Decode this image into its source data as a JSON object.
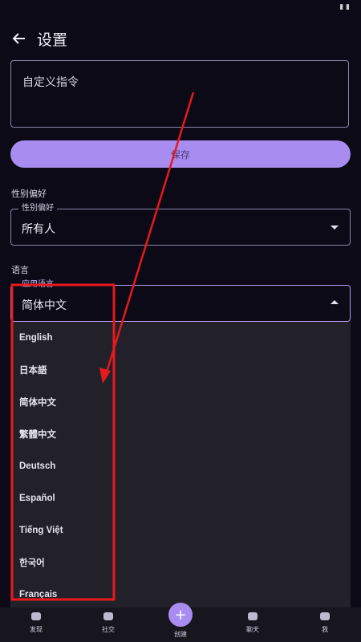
{
  "header": {
    "title": "设置"
  },
  "instruction": {
    "placeholder": "自定义指令"
  },
  "save_label": "保存",
  "gender": {
    "section": "性别偏好",
    "legend": "性别偏好",
    "value": "所有人"
  },
  "language": {
    "section": "语言",
    "legend": "应用语言",
    "value": "简体中文",
    "options": [
      "English",
      "日本語",
      "简体中文",
      "繁體中文",
      "Deutsch",
      "Español",
      "Tiếng Việt",
      "한국어",
      "Français"
    ]
  },
  "nav": [
    {
      "label": "发现",
      "icon": "compass-icon"
    },
    {
      "label": "社交",
      "icon": "people-icon"
    },
    {
      "label": "创建",
      "icon": "plus-icon"
    },
    {
      "label": "聊天",
      "icon": "chat-icon"
    },
    {
      "label": "我",
      "icon": "person-icon"
    }
  ],
  "colors": {
    "accent": "#a98cf0",
    "background": "#0b0a16",
    "annotation": "#e8191c"
  }
}
